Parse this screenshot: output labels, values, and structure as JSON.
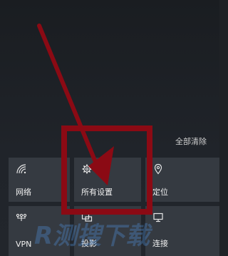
{
  "action_center": {
    "clear_all_label": "全部清除"
  },
  "quick_actions": [
    {
      "label": "网络",
      "icon": "network-signal-icon"
    },
    {
      "label": "所有设置",
      "icon": "gear-icon"
    },
    {
      "label": "定位",
      "icon": "location-icon"
    },
    {
      "label": "VPN",
      "icon": "vpn-icon"
    },
    {
      "label": "投影",
      "icon": "project-icon"
    },
    {
      "label": "连接",
      "icon": "connect-icon"
    }
  ],
  "annotation": {
    "color": "#8b0a14"
  },
  "watermark": {
    "text": "R测搜下载"
  }
}
